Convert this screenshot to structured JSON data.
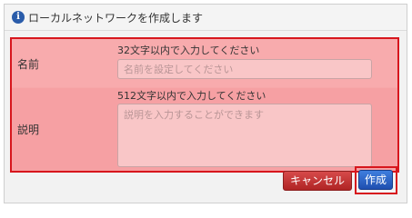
{
  "header": {
    "icon": "info-icon",
    "title": "ローカルネットワークを作成します"
  },
  "form": {
    "name": {
      "label": "名前",
      "hint": "32文字以内で入力してください",
      "placeholder": "名前を設定してください",
      "value": ""
    },
    "description": {
      "label": "説明",
      "hint": "512文字以内で入力してください",
      "placeholder": "説明を入力することができます",
      "value": ""
    },
    "highlight_color": "#d7161d"
  },
  "buttons": {
    "cancel_label": "キャンセル",
    "create_label": "作成"
  }
}
